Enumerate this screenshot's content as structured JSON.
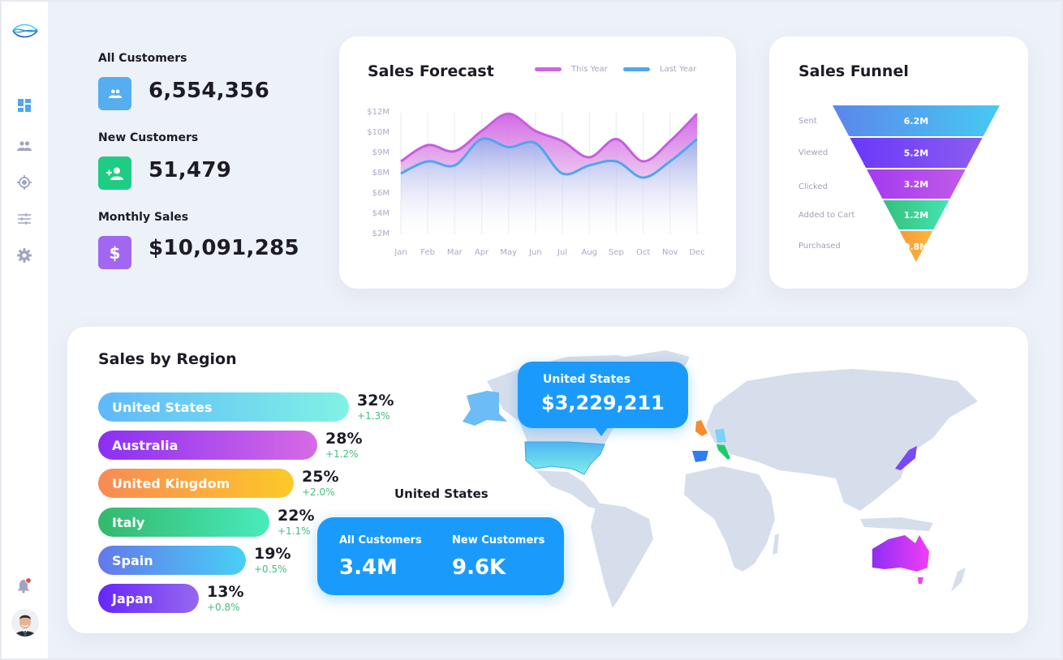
{
  "sidebar": {
    "logo_icon": "wave-logo-icon",
    "items": [
      {
        "name": "dashboard",
        "icon": "dashboard-icon",
        "active": true
      },
      {
        "name": "customers",
        "icon": "people-icon",
        "active": false
      },
      {
        "name": "target",
        "icon": "target-icon",
        "active": false
      },
      {
        "name": "filters",
        "icon": "sliders-icon",
        "active": false
      },
      {
        "name": "settings",
        "icon": "gear-icon",
        "active": false
      }
    ],
    "notifications_icon": "bell-icon",
    "has_unread_notifications": true
  },
  "stats": [
    {
      "label": "All Customers",
      "value": "6,554,356",
      "icon": "people-icon",
      "color": "#56aef0"
    },
    {
      "label": "New Customers",
      "value": "51,479",
      "icon": "add-person-icon",
      "color": "#1fcc83"
    },
    {
      "label": "Monthly Sales",
      "value": "$10,091,285",
      "icon": "dollar-icon",
      "color": "#a267f0"
    }
  ],
  "forecast": {
    "title": "Sales Forecast",
    "legend": [
      {
        "label": "This Year",
        "color": "#d063e5"
      },
      {
        "label": "Last Year",
        "color": "#4ea7ef"
      }
    ]
  },
  "chart_data": [
    {
      "type": "area",
      "title": "Sales Forecast",
      "xlabel": "",
      "ylabel": "",
      "categories": [
        "Jan",
        "Feb",
        "Mar",
        "Apr",
        "May",
        "Jun",
        "Jul",
        "Aug",
        "Sep",
        "Oct",
        "Nov",
        "Dec"
      ],
      "yticks": [
        "$2M",
        "$4M",
        "$6M",
        "$8M",
        "$9M",
        "$10M",
        "$12M"
      ],
      "ylim": [
        2,
        12
      ],
      "grid": "vertical",
      "legend_position": "top-right",
      "series": [
        {
          "name": "This Year",
          "values": [
            8.6,
            9.4,
            9.1,
            10.2,
            11.9,
            10.2,
            9.6,
            8.8,
            9.7,
            8.6,
            9.6,
            11.9
          ]
        },
        {
          "name": "Last Year",
          "values": [
            8.0,
            8.6,
            8.4,
            9.7,
            9.3,
            9.5,
            8.0,
            8.4,
            8.6,
            7.6,
            8.6,
            9.7
          ]
        }
      ]
    },
    {
      "type": "bar",
      "title": "Sales Funnel",
      "categories": [
        "Sent",
        "Viewed",
        "Clicked",
        "Added to Cart",
        "Purchased"
      ],
      "values": [
        6.2,
        5.2,
        3.2,
        1.2,
        0.8
      ],
      "labels": [
        "6.2M",
        "5.2M",
        "3.2M",
        "1.2M",
        "0.8M"
      ],
      "colors": [
        [
          "#5c86ec",
          "#47c9f2"
        ],
        [
          "#6a38fa",
          "#8c5cf0"
        ],
        [
          "#a43af0",
          "#c25ae8"
        ],
        [
          "#35c07b",
          "#45e4b0"
        ],
        [
          "#f69a3b",
          "#ffb73a"
        ]
      ]
    },
    {
      "type": "bar",
      "title": "Sales by Region",
      "categories": [
        "United States",
        "Australia",
        "United Kingdom",
        "Italy",
        "Spain",
        "Japan"
      ],
      "values": [
        32,
        28,
        25,
        22,
        19,
        13
      ],
      "changes": [
        "+1.3%",
        "+1.2%",
        "+2.0%",
        "+1.1%",
        "+0.5%",
        "+0.8%"
      ]
    }
  ],
  "funnel": {
    "title": "Sales Funnel"
  },
  "regions": {
    "title": "Sales by Region",
    "items": [
      {
        "name": "United States",
        "pct": "32%",
        "change": "+1.3%",
        "c1": "#5fb8fa",
        "c2": "#80f2e4"
      },
      {
        "name": "Australia",
        "pct": "28%",
        "change": "+1.2%",
        "c1": "#8a2ff2",
        "c2": "#d66be6"
      },
      {
        "name": "United Kingdom",
        "pct": "25%",
        "change": "+2.0%",
        "c1": "#f88a55",
        "c2": "#fdc929"
      },
      {
        "name": "Italy",
        "pct": "22%",
        "change": "+1.1%",
        "c1": "#33b86c",
        "c2": "#49ebbc"
      },
      {
        "name": "Spain",
        "pct": "19%",
        "change": "+0.5%",
        "c1": "#6478ea",
        "c2": "#48d0f5"
      },
      {
        "name": "Japan",
        "pct": "13%",
        "change": "+0.8%",
        "c1": "#6626fa",
        "c2": "#9668ee"
      }
    ]
  },
  "map": {
    "tooltip_country": "United States",
    "tooltip_value": "$3,229,211",
    "selected_country": "United States",
    "info": [
      {
        "label": "All Customers",
        "value": "3.4M"
      },
      {
        "label": "New Customers",
        "value": "9.6K"
      }
    ],
    "base_color": "#d6deec"
  }
}
